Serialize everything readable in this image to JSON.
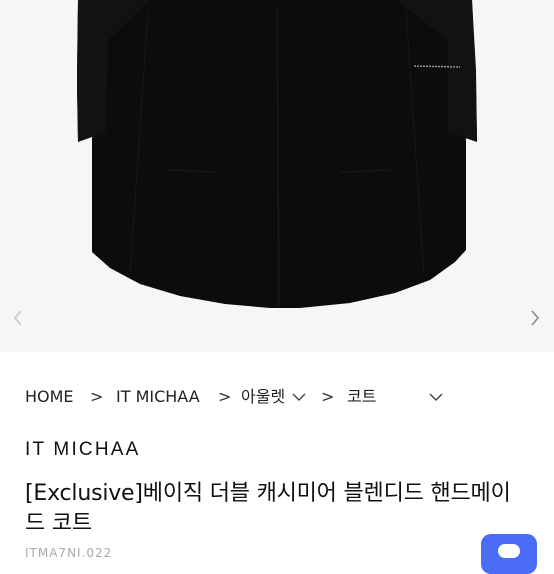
{
  "breadcrumb": {
    "home": "HOME",
    "sep1": ">",
    "brand": "IT MICHAA",
    "sep2": ">",
    "category": "아울렛",
    "sep3": ">",
    "subcategory": "코트"
  },
  "product": {
    "brand": "IT MICHAA",
    "title": "[Exclusive]베이직 더블 캐시미어 블렌디드 핸드메이드 코트",
    "code": "ITMA7NI.022"
  },
  "gallery": {
    "prev_icon": "chevron-left-icon",
    "next_icon": "chevron-right-icon",
    "coat_color": "#0c0c0c",
    "background": "#f6f6f6"
  },
  "colors": {
    "chat_button": "#4a6cf7"
  }
}
